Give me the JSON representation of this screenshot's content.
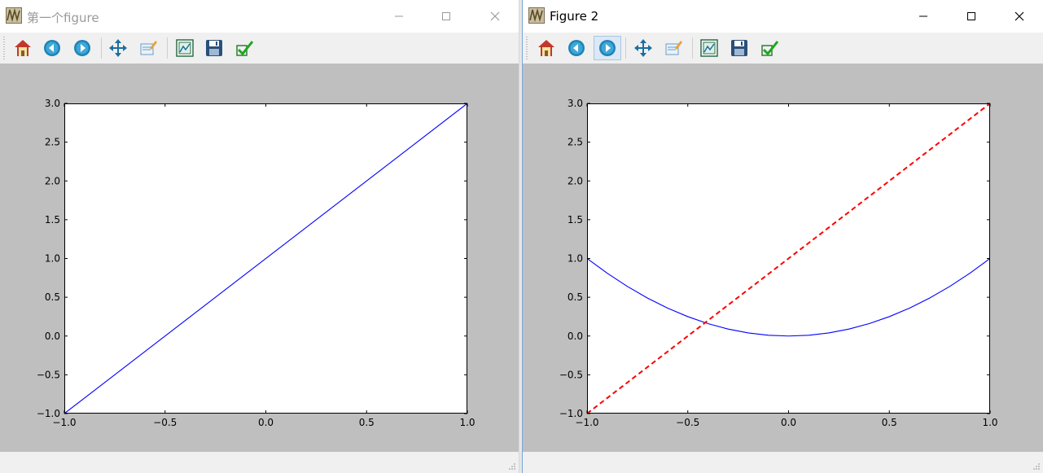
{
  "windows": [
    {
      "title": "第一个figure",
      "active": false,
      "plot": {
        "xlim": [
          -1.0,
          1.0
        ],
        "ylim": [
          -1.0,
          3.0
        ],
        "xtick_labels": [
          "−1.0",
          "−0.5",
          "0.0",
          "0.5",
          "1.0"
        ],
        "ytick_labels": [
          "−1.0",
          "−0.5",
          "0.0",
          "0.5",
          "1.0",
          "1.5",
          "2.0",
          "2.5",
          "3.0"
        ],
        "series": [
          {
            "style": "solid",
            "color": "#0000ff",
            "x": [
              -1.0,
              1.0
            ],
            "y": [
              -1.0,
              3.0
            ]
          }
        ]
      }
    },
    {
      "title": "Figure 2",
      "active": true,
      "plot": {
        "xlim": [
          -1.0,
          1.0
        ],
        "ylim": [
          -1.0,
          3.0
        ],
        "xtick_labels": [
          "−1.0",
          "−0.5",
          "0.0",
          "0.5",
          "1.0"
        ],
        "ytick_labels": [
          "−1.0",
          "−0.5",
          "0.0",
          "0.5",
          "1.0",
          "1.5",
          "2.0",
          "2.5",
          "3.0"
        ],
        "series": [
          {
            "style": "solid",
            "color": "#0000ff",
            "x": [
              -1.0,
              -0.9,
              -0.8,
              -0.7,
              -0.6,
              -0.5,
              -0.4,
              -0.3,
              -0.2,
              -0.1,
              0.0,
              0.1,
              0.2,
              0.3,
              0.4,
              0.5,
              0.6,
              0.7,
              0.8,
              0.9,
              1.0
            ],
            "y": [
              1.0,
              0.81,
              0.64,
              0.49,
              0.36,
              0.25,
              0.16,
              0.09,
              0.04,
              0.01,
              0.0,
              0.01,
              0.04,
              0.09,
              0.16,
              0.25,
              0.36,
              0.49,
              0.64,
              0.81,
              1.0
            ]
          },
          {
            "style": "dashed",
            "color": "#ff0000",
            "x": [
              -1.0,
              1.0
            ],
            "y": [
              -1.0,
              3.0
            ]
          }
        ]
      }
    }
  ],
  "chart_data": [
    {
      "type": "line",
      "title": "",
      "xlabel": "",
      "ylabel": "",
      "xlim": [
        -1.0,
        1.0
      ],
      "ylim": [
        -1.0,
        3.0
      ],
      "xticks": [
        -1.0,
        -0.5,
        0.0,
        0.5,
        1.0
      ],
      "yticks": [
        -1.0,
        -0.5,
        0.0,
        0.5,
        1.0,
        1.5,
        2.0,
        2.5,
        3.0
      ],
      "grid": false,
      "series": [
        {
          "color": "#0000ff",
          "linestyle": "solid",
          "x": [
            -1.0,
            1.0
          ],
          "y": [
            -1.0,
            3.0
          ]
        }
      ]
    },
    {
      "type": "line",
      "title": "",
      "xlabel": "",
      "ylabel": "",
      "xlim": [
        -1.0,
        1.0
      ],
      "ylim": [
        -1.0,
        3.0
      ],
      "xticks": [
        -1.0,
        -0.5,
        0.0,
        0.5,
        1.0
      ],
      "yticks": [
        -1.0,
        -0.5,
        0.0,
        0.5,
        1.0,
        1.5,
        2.0,
        2.5,
        3.0
      ],
      "grid": false,
      "series": [
        {
          "color": "#0000ff",
          "linestyle": "solid",
          "x": [
            -1.0,
            -0.9,
            -0.8,
            -0.7,
            -0.6,
            -0.5,
            -0.4,
            -0.3,
            -0.2,
            -0.1,
            0.0,
            0.1,
            0.2,
            0.3,
            0.4,
            0.5,
            0.6,
            0.7,
            0.8,
            0.9,
            1.0
          ],
          "y": [
            1.0,
            0.81,
            0.64,
            0.49,
            0.36,
            0.25,
            0.16,
            0.09,
            0.04,
            0.01,
            0.0,
            0.01,
            0.04,
            0.09,
            0.16,
            0.25,
            0.36,
            0.49,
            0.64,
            0.81,
            1.0
          ]
        },
        {
          "color": "#ff0000",
          "linestyle": "dashed",
          "x": [
            -1.0,
            1.0
          ],
          "y": [
            -1.0,
            3.0
          ]
        }
      ]
    }
  ],
  "toolbar": {
    "buttons": [
      "home-icon",
      "back-icon",
      "forward-icon",
      "pan-icon",
      "zoom-icon",
      "subplots-icon",
      "save-icon",
      "customize-icon"
    ],
    "window2_highlighted": "forward-icon"
  },
  "colors": {
    "canvas_bg": "#bfbfbf",
    "axes_bg": "#ffffff",
    "inactive_title": "#9a9a9a",
    "active_title": "#000000",
    "window_bg": "#f0f0f0"
  }
}
